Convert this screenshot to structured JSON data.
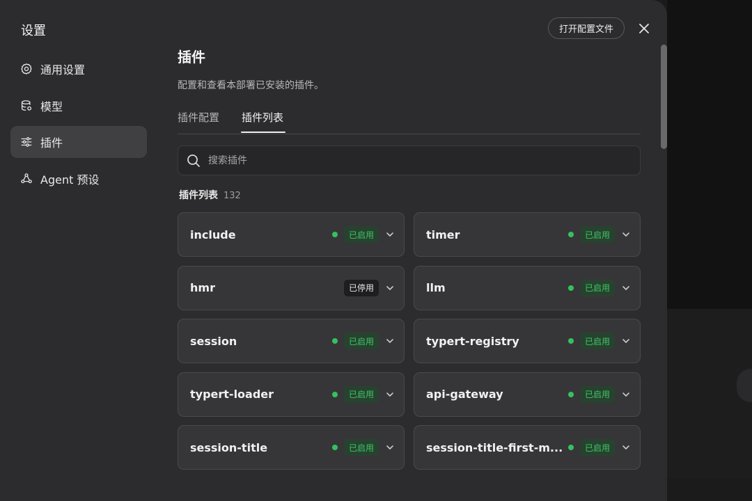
{
  "dialog": {
    "title": "设置",
    "open_config_label": "打开配置文件",
    "close_icon": "close-icon"
  },
  "sidebar": {
    "items": [
      {
        "label": "通用设置",
        "icon": "gear-icon",
        "active": false
      },
      {
        "label": "模型",
        "icon": "database-icon",
        "active": false
      },
      {
        "label": "插件",
        "icon": "sliders-icon",
        "active": true
      },
      {
        "label": "Agent 预设",
        "icon": "agent-icon",
        "active": false
      }
    ]
  },
  "main": {
    "title": "插件",
    "description": "配置和查看本部署已安装的插件。",
    "tabs": [
      {
        "label": "插件配置",
        "active": false
      },
      {
        "label": "插件列表",
        "active": true
      }
    ],
    "search": {
      "placeholder": "搜索插件",
      "value": ""
    },
    "list_heading": "插件列表",
    "list_count": "132",
    "plugins": [
      {
        "name": "include",
        "status": "已启用",
        "enabled": true
      },
      {
        "name": "timer",
        "status": "已启用",
        "enabled": true
      },
      {
        "name": "hmr",
        "status": "已停用",
        "enabled": false
      },
      {
        "name": "llm",
        "status": "已启用",
        "enabled": true
      },
      {
        "name": "session",
        "status": "已启用",
        "enabled": true
      },
      {
        "name": "typert-registry",
        "status": "已启用",
        "enabled": true
      },
      {
        "name": "typert-loader",
        "status": "已启用",
        "enabled": true
      },
      {
        "name": "api-gateway",
        "status": "已启用",
        "enabled": true
      },
      {
        "name": "session-title",
        "status": "已启用",
        "enabled": true
      },
      {
        "name": "session-title-first-m...",
        "status": "已启用",
        "enabled": true
      }
    ]
  },
  "colors": {
    "dialog_bg": "#2c2c2e",
    "card_bg": "#363638",
    "enabled_green": "#35c15e",
    "enabled_badge_bg": "#27432f"
  }
}
